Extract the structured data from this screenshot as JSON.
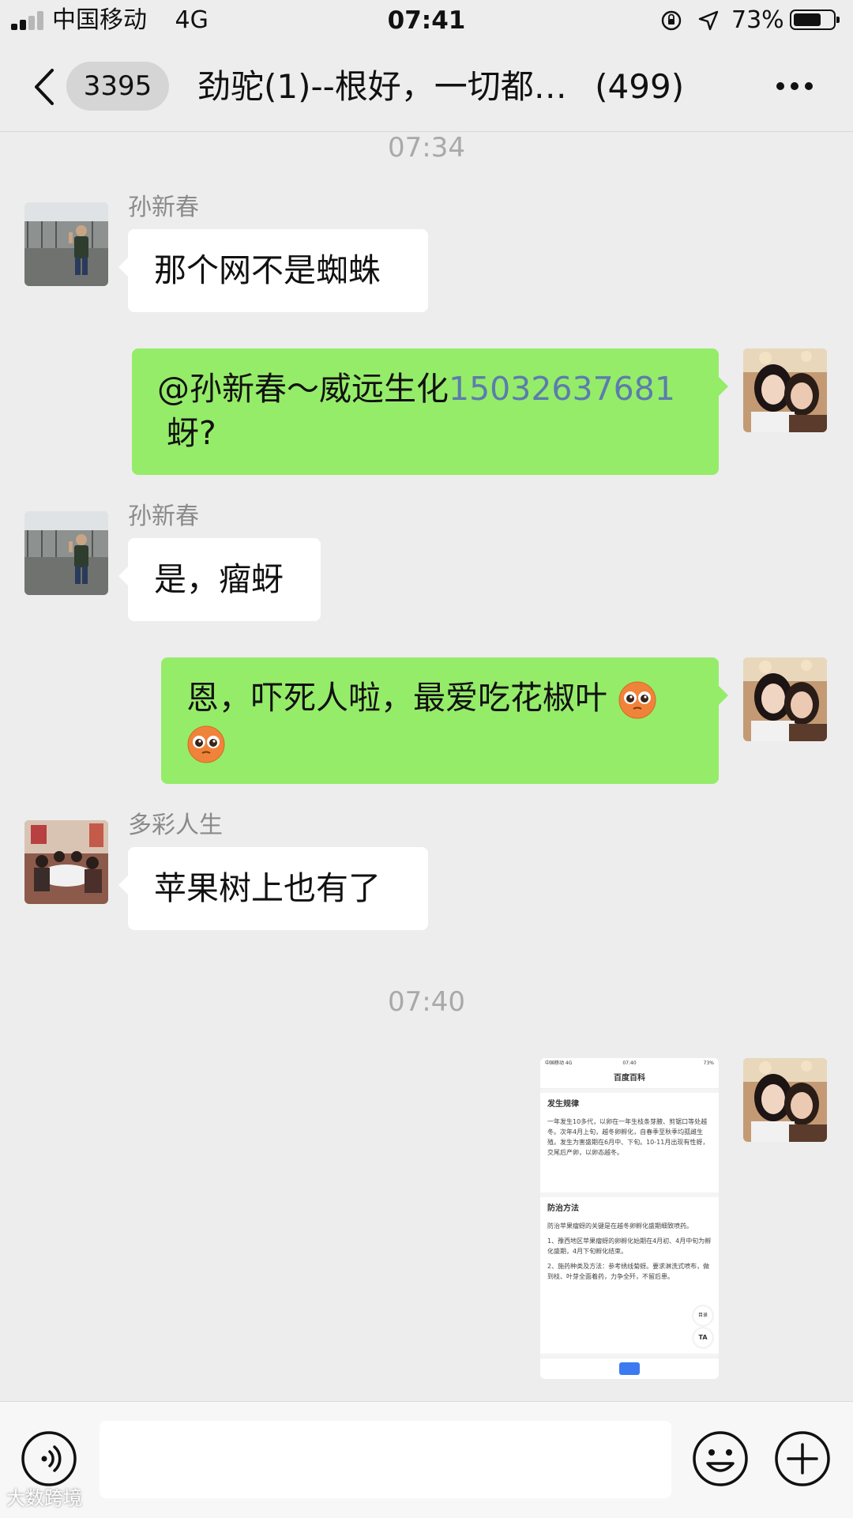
{
  "status_bar": {
    "carrier": "中国移动",
    "network": "4G",
    "time": "07:41",
    "battery_percent": "73%",
    "battery_level": 0.73,
    "signal_bars": 2,
    "icons": [
      "orientation-lock-icon",
      "location-arrow-icon",
      "battery-icon"
    ]
  },
  "nav": {
    "back_icon": "chevron-left-icon",
    "unread_count": "3395",
    "title": "劲驼(1)--根好，一切都…",
    "member_count": "(499)",
    "more_icon": "more-dots-icon"
  },
  "messages": [
    {
      "type": "time",
      "text": "07:34"
    },
    {
      "type": "incoming",
      "sender": "孙新春",
      "text": "那个网不是蜘蛛"
    },
    {
      "type": "outgoing",
      "text_prefix": "@孙新春～威远生化",
      "phone": "15032637681",
      "text_suffix": "蚜?"
    },
    {
      "type": "incoming",
      "sender": "孙新春",
      "text": "是，瘤蚜"
    },
    {
      "type": "outgoing",
      "text": "恩，吓死人啦，最爱吃花椒叶",
      "emoji": "pleading-face-emoji"
    },
    {
      "type": "incoming",
      "sender": "多彩人生",
      "text": "苹果树上也有了"
    },
    {
      "type": "time",
      "text": "07:40"
    },
    {
      "type": "outgoing-image",
      "description": "screenshot"
    }
  ],
  "thumbnail": {
    "status_left": "中国移动 4G",
    "status_time": "07:40",
    "status_right": "73%",
    "header": "百度百科",
    "section1_title": "发生规律",
    "section1_text": "一年发生10多代，以卵在一年生枝条芽腋、剪锯口等处越冬。次年4月上旬，越冬卵孵化，自春季至秋季均孤雌生殖。发生为害盛期在6月中、下旬。10-11月出现有性蚜，交尾后产卵，以卵态越冬。",
    "section2_title": "防治方法",
    "section2_text1": "防治苹果瘤蚜的关键是在越冬卵孵化盛期细致喷药。",
    "section2_text2": "1、豫西地区苹果瘤蚜的卵孵化始期在4月初、4月中旬为孵化盛期，4月下旬孵化结束。",
    "section2_text3": "2、施药种类及方法：参考绣线菊蚜。要求淋洗式喷布，做到枝、叶芽全面着药，力争全歼，不留后患。",
    "toc_label": "目录",
    "font_label": "TA"
  },
  "input_bar": {
    "voice_icon": "voice-icon",
    "input_value": "",
    "emoji_icon": "smiley-icon",
    "plus_icon": "plus-circle-icon"
  },
  "watermark": "大数跨境",
  "colors": {
    "background": "#ededed",
    "outgoing_bubble": "#95ec69",
    "incoming_bubble": "#ffffff",
    "link": "#5c7cad",
    "timestamp": "#a9a9a9"
  }
}
